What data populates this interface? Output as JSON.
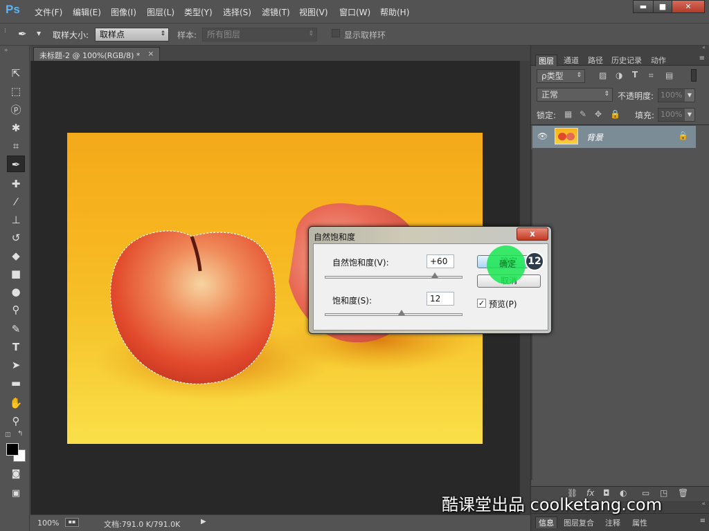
{
  "app": {
    "logo": "Ps",
    "menus": [
      "文件(F)",
      "编辑(E)",
      "图像(I)",
      "图层(L)",
      "类型(Y)",
      "选择(S)",
      "滤镜(T)",
      "视图(V)",
      "窗口(W)",
      "帮助(H)"
    ],
    "window_controls": {
      "minimize": "▬",
      "maximize": "■",
      "close": "✕"
    }
  },
  "options_bar": {
    "sample_size_label": "取样大小:",
    "sample_size_value": "取样点",
    "sample_label": "样本:",
    "sample_value": "所有图层",
    "show_ring_label": "显示取样环"
  },
  "document": {
    "tab_title": "未标题-2 @ 100%(RGB/8) *",
    "close": "×",
    "zoom": "100%",
    "doc_info": "文档:791.0 K/791.0K"
  },
  "tools": [
    "move-icon",
    "marquee-icon",
    "lasso-icon",
    "magic-wand-icon",
    "crop-icon",
    "eyedropper-icon",
    "healing-icon",
    "brush-icon",
    "stamp-icon",
    "history-brush-icon",
    "eraser-icon",
    "gradient-icon",
    "blur-icon",
    "dodge-icon",
    "pen-icon",
    "type-icon",
    "path-select-icon",
    "rectangle-icon",
    "hand-icon",
    "zoom-icon"
  ],
  "panels": {
    "tabs": [
      "图层",
      "通道",
      "路径",
      "历史记录",
      "动作"
    ],
    "active_tab": "图层",
    "filter_kind": "ρ类型",
    "blend_mode": "正常",
    "opacity_label": "不透明度:",
    "opacity_value": "100%",
    "lock_label": "锁定:",
    "fill_label": "填充:",
    "fill_value": "100%",
    "layer_name": "背景",
    "bottom_tabs": [
      "信息",
      "图层复合",
      "注释",
      "属性"
    ]
  },
  "dialog": {
    "title": "自然饱和度",
    "close": "x",
    "vibrance_label": "自然饱和度(V):",
    "vibrance_value": "+60",
    "vibrance_slider": 0.8,
    "saturation_label": "饱和度(S):",
    "saturation_value": "12",
    "saturation_slider": 0.56,
    "ok_label": "确定",
    "cancel_label": "取消",
    "preview_label": "预览(P)",
    "preview_checked": "✓",
    "step_badge": "12"
  },
  "watermark": "酷课堂出品 coolketang.com",
  "colors": {
    "accent": "#1c8fe0",
    "highlight": "#19e650",
    "badge": "#2d3b4a"
  }
}
